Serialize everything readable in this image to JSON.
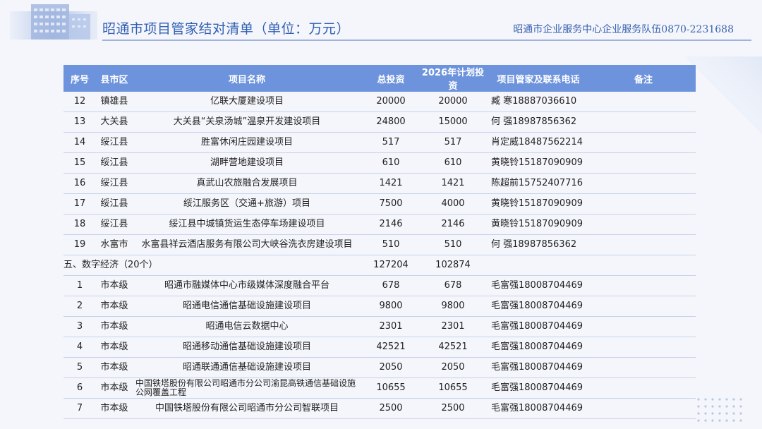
{
  "header": {
    "title": "昭通市项目管家结对清单（单位：万元）",
    "contact": "昭通市企业服务中心企业服务队伍0870-2231688"
  },
  "table": {
    "columns": [
      "序号",
      "县市区",
      "项目名称",
      "总投资",
      "2026年计划投资",
      "项目管家及联系电话",
      "备注"
    ],
    "rows_a": [
      [
        "12",
        "镇雄县",
        "亿联大厦建设项目",
        "20000",
        "20000",
        "臧  寒18887036610",
        ""
      ],
      [
        "13",
        "大关县",
        "大关县“关泉汤城”温泉开发建设项目",
        "24800",
        "15000",
        "何  强18987856362",
        ""
      ],
      [
        "14",
        "绥江县",
        "胜富休闲庄园建设项目",
        "517",
        "517",
        "肖定威18487562214",
        ""
      ],
      [
        "15",
        "绥江县",
        "湖畔营地建设项目",
        "610",
        "610",
        "黄晓铃15187090909",
        ""
      ],
      [
        "16",
        "绥江县",
        "真武山农旅融合发展项目",
        "1421",
        "1421",
        "陈超前15752407716",
        ""
      ],
      [
        "17",
        "绥江县",
        "绥江服务区（交通+旅游）项目",
        "7500",
        "4000",
        "黄晓铃15187090909",
        ""
      ],
      [
        "18",
        "绥江县",
        "绥江县中城镇货运生态停车场建设项目",
        "2146",
        "2146",
        "黄晓铃15187090909",
        ""
      ],
      [
        "19",
        "水富市",
        "水富县祥云酒店服务有限公司大峡谷洗衣房建设项目",
        "510",
        "510",
        "何  强18987856362",
        ""
      ]
    ],
    "section": {
      "label": "五、数字经济（20个）",
      "total": "127204",
      "plan": "102874"
    },
    "rows_b": [
      [
        "1",
        "市本级",
        "昭通市融媒体中心市级媒体深度融合平台",
        "678",
        "678",
        "毛富强18008704469",
        ""
      ],
      [
        "2",
        "市本级",
        "昭通电信通信基础设施建设项目",
        "9800",
        "9800",
        "毛富强18008704469",
        ""
      ],
      [
        "3",
        "市本级",
        "昭通电信云数据中心",
        "2301",
        "2301",
        "毛富强18008704469",
        ""
      ],
      [
        "4",
        "市本级",
        "昭通移动通信基础设施建设项目",
        "42521",
        "42521",
        "毛富强18008704469",
        ""
      ],
      [
        "5",
        "市本级",
        "昭通联通通信基础设施建设项目",
        "2050",
        "2050",
        "毛富强18008704469",
        ""
      ],
      [
        "6",
        "市本级",
        "中国铁塔股份有限公司昭通市分公司渝昆高铁通信基础设施公网覆盖工程",
        "10655",
        "10655",
        "毛富强18008704469",
        ""
      ],
      [
        "7",
        "市本级",
        "中国铁塔股份有限公司昭通市分公司智联项目",
        "2500",
        "2500",
        "毛富强18008704469",
        ""
      ]
    ]
  },
  "colors": {
    "header_bg": "#6d93dd",
    "title": "#2f5fb3",
    "row_border": "#c6d2ea"
  }
}
